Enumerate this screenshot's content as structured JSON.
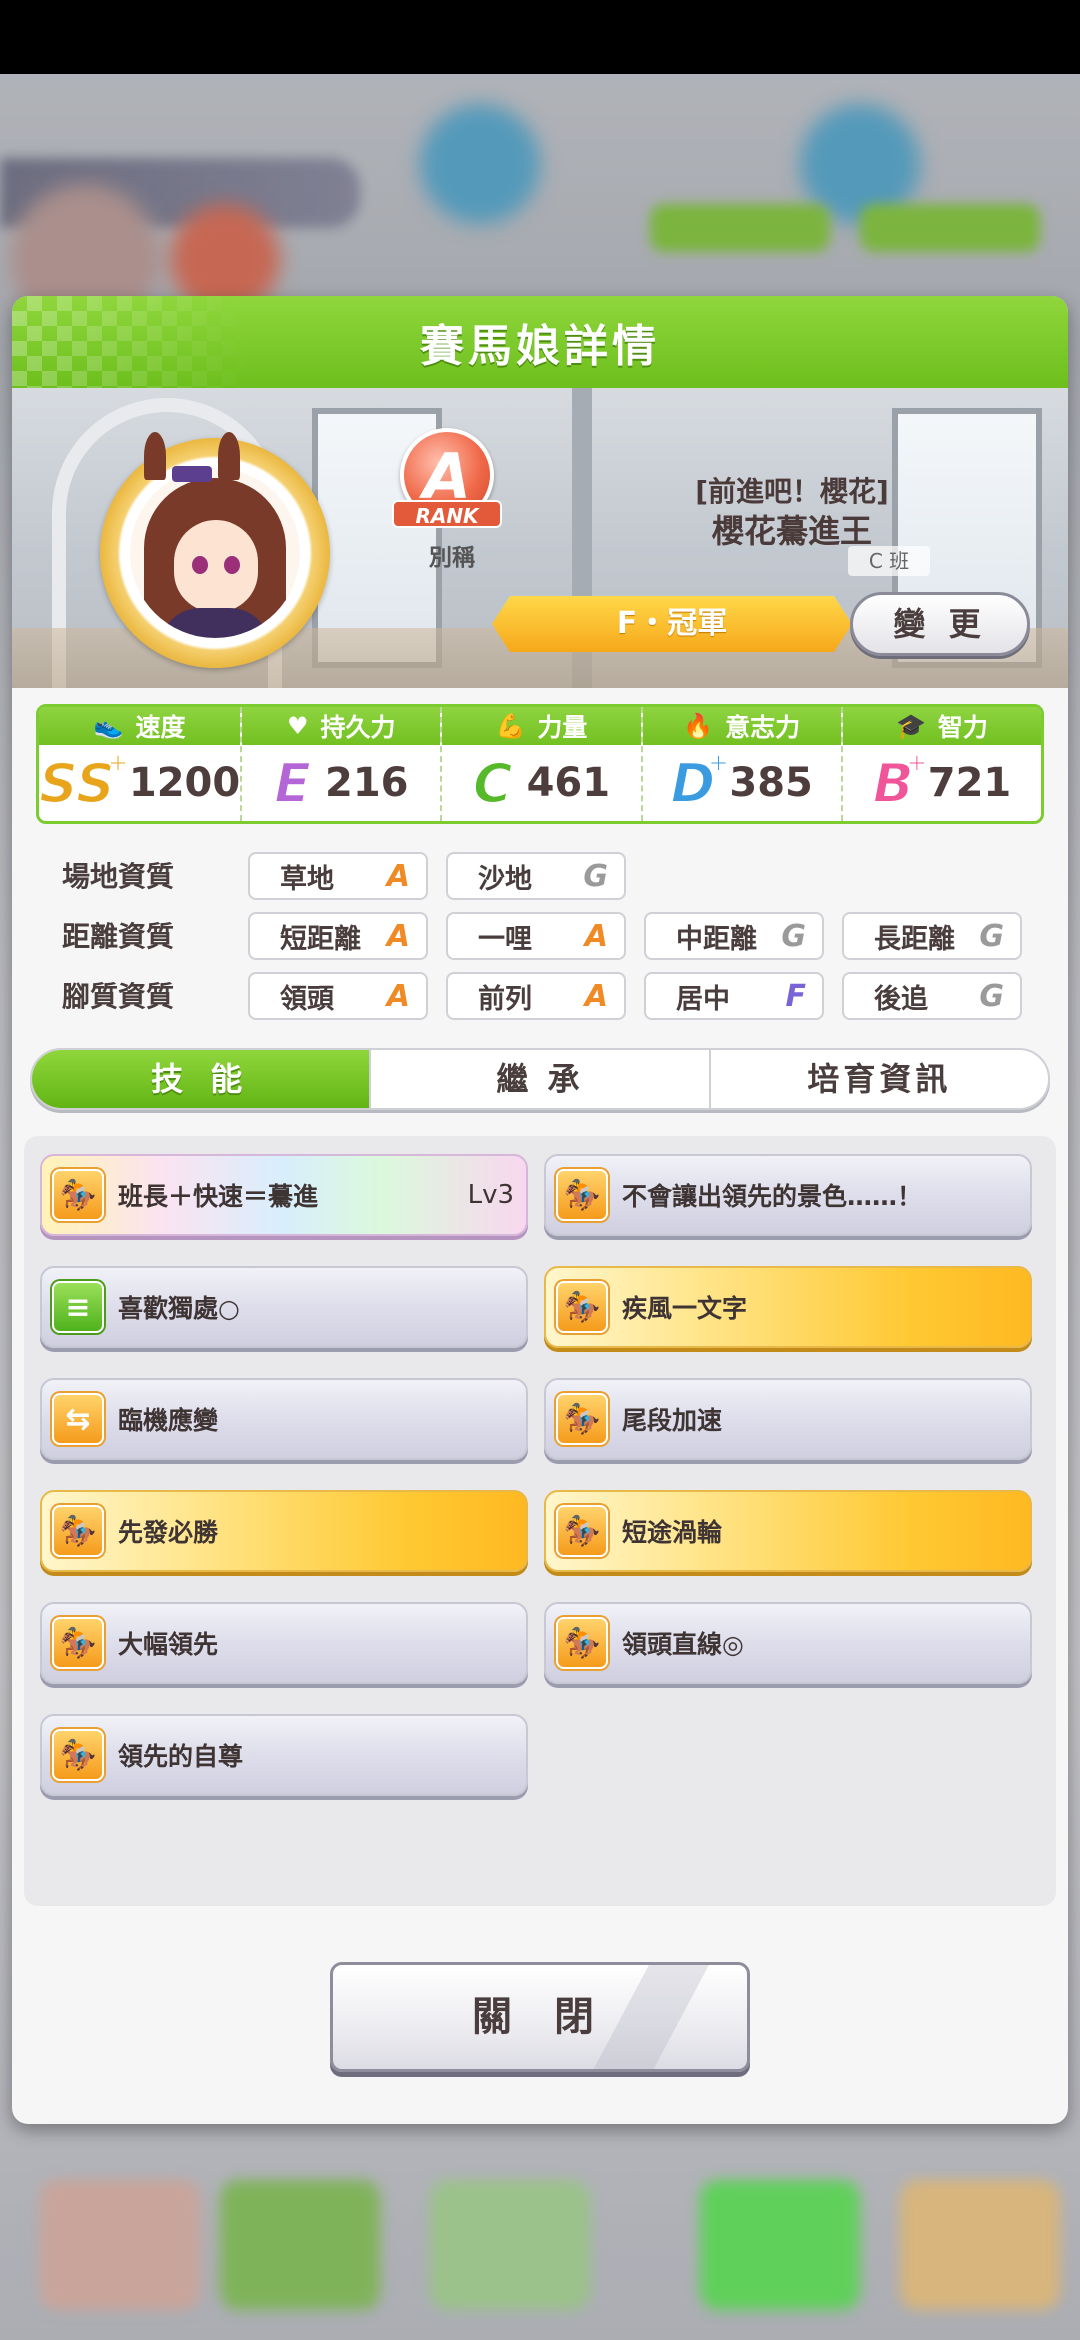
{
  "dialog": {
    "title": "賽馬娘詳情",
    "rank": {
      "letter": "A",
      "ribbon": "RANK",
      "caption": "別稱"
    },
    "nickname_top": "[前進吧！櫻花]",
    "nickname_name": "櫻花驀進王",
    "class_tag": "C 班",
    "title_badge": "F・冠軍",
    "change_button": "變 更",
    "stats": [
      {
        "label": "速度",
        "icon": "boot-icon",
        "glyph": "👟",
        "grade": "SS",
        "plus": "+",
        "value": "1200",
        "color": "#e8a51c"
      },
      {
        "label": "持久力",
        "icon": "heart-icon",
        "glyph": "♥",
        "grade": "E",
        "plus": "",
        "value": "216",
        "color": "#b466d6"
      },
      {
        "label": "力量",
        "icon": "muscle-icon",
        "glyph": "💪",
        "grade": "C",
        "plus": "",
        "value": "461",
        "color": "#55b92a"
      },
      {
        "label": "意志力",
        "icon": "flame-icon",
        "glyph": "🔥",
        "grade": "D",
        "plus": "+",
        "value": "385",
        "color": "#3b9be0"
      },
      {
        "label": "智力",
        "icon": "graduation-cap-icon",
        "glyph": "🎓",
        "grade": "B",
        "plus": "+",
        "value": "721",
        "color": "#f0559a"
      }
    ],
    "aptitude": {
      "track": {
        "label": "場地資質",
        "items": [
          {
            "name": "草地",
            "grade": "A"
          },
          {
            "name": "沙地",
            "grade": "G"
          }
        ]
      },
      "distance": {
        "label": "距離資質",
        "items": [
          {
            "name": "短距離",
            "grade": "A"
          },
          {
            "name": "一哩",
            "grade": "A"
          },
          {
            "name": "中距離",
            "grade": "G"
          },
          {
            "name": "長距離",
            "grade": "G"
          }
        ]
      },
      "style": {
        "label": "腳質資質",
        "items": [
          {
            "name": "領頭",
            "grade": "A"
          },
          {
            "name": "前列",
            "grade": "A"
          },
          {
            "name": "居中",
            "grade": "F"
          },
          {
            "name": "後追",
            "grade": "G"
          }
        ]
      }
    },
    "tabs": [
      "技 能",
      "繼 承",
      "培育資訊"
    ],
    "skills": [
      {
        "name": "班長＋快速＝驀進",
        "level": "Lv3",
        "style": "rainbow",
        "icon": "runner-icon"
      },
      {
        "name": "不會讓出領先的景色……！",
        "level": "",
        "style": "normal",
        "icon": "runner-icon"
      },
      {
        "name": "喜歡獨處○",
        "level": "",
        "style": "normal",
        "icon": "document-icon"
      },
      {
        "name": "疾風一文字",
        "level": "",
        "style": "gold",
        "icon": "runner-icon"
      },
      {
        "name": "臨機應變",
        "level": "",
        "style": "normal",
        "icon": "arrows-icon"
      },
      {
        "name": "尾段加速",
        "level": "",
        "style": "normal",
        "icon": "runner-icon"
      },
      {
        "name": "先發必勝",
        "level": "",
        "style": "gold",
        "icon": "runner-icon"
      },
      {
        "name": "短途渦輪",
        "level": "",
        "style": "gold",
        "icon": "runner-icon"
      },
      {
        "name": "大幅領先",
        "level": "",
        "style": "normal",
        "icon": "runner-icon"
      },
      {
        "name": "領頭直線◎",
        "level": "",
        "style": "normal",
        "icon": "runner-icon"
      },
      {
        "name": "領先的自尊",
        "level": "",
        "style": "normal",
        "icon": "runner-icon"
      }
    ],
    "close_button": "關 閉"
  },
  "grade_colors": {
    "A": "#f08a24",
    "G": "#9a9a9a",
    "F": "#7a63d6"
  }
}
